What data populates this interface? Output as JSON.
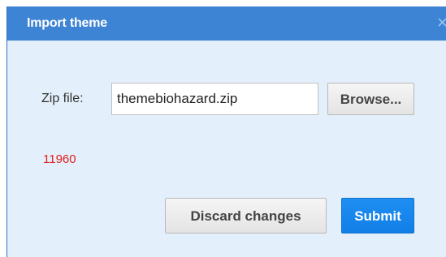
{
  "dialog": {
    "title": "Import theme",
    "close_icon": "×",
    "zip_label": "Zip file:",
    "zip_value": "themebiohazard.zip",
    "browse_label": "Browse...",
    "error_code": "11960",
    "discard_label": "Discard changes",
    "submit_label": "Submit"
  },
  "colors": {
    "titlebar": "#3d84d4",
    "body": "#e3effa",
    "submit": "#1f8ef2",
    "error": "#e02020"
  },
  "icons": {
    "close": "close-icon"
  }
}
